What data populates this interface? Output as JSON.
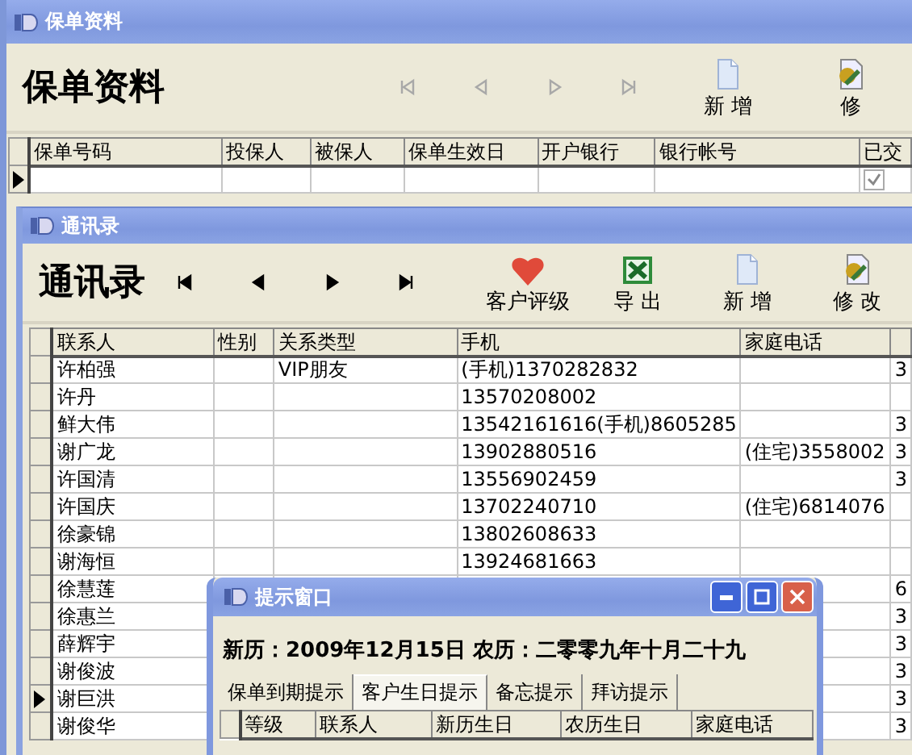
{
  "policy_window": {
    "title": "保单资料",
    "heading": "保单资料",
    "nav_buttons": [
      {
        "kind": "first",
        "disabled": true
      },
      {
        "kind": "prev",
        "disabled": true
      },
      {
        "kind": "next",
        "disabled": true
      },
      {
        "kind": "last",
        "disabled": true
      }
    ],
    "actions": [
      {
        "kind": "new",
        "label": "新 增"
      },
      {
        "kind": "edit",
        "label": "修"
      }
    ],
    "table": {
      "columns": [
        "保单号码",
        "投保人",
        "被保人",
        "保单生效日",
        "开户银行",
        "银行帐号",
        "已交"
      ],
      "rows": [
        {
          "current": true,
          "cells": [
            "",
            "",
            "",
            "",
            "",
            ""
          ],
          "paid_checked": true
        }
      ]
    }
  },
  "contacts_window": {
    "title": "通讯录",
    "heading": "通讯录",
    "nav_buttons": [
      {
        "kind": "first",
        "disabled": false
      },
      {
        "kind": "prev",
        "disabled": false
      },
      {
        "kind": "next",
        "disabled": false
      },
      {
        "kind": "last",
        "disabled": false
      }
    ],
    "actions": [
      {
        "kind": "rating",
        "label": "客户评级"
      },
      {
        "kind": "export",
        "label": "导 出"
      },
      {
        "kind": "new",
        "label": "新 增"
      },
      {
        "kind": "edit",
        "label": "修 改"
      }
    ],
    "table": {
      "columns": [
        "联系人",
        "性别",
        "关系类型",
        "手机",
        "家庭电话"
      ],
      "rows": [
        {
          "current": false,
          "cells": [
            "许柏强",
            "",
            "VIP朋友",
            "(手机)1370282832",
            "",
            "3"
          ]
        },
        {
          "current": false,
          "cells": [
            "许丹",
            "",
            "",
            "13570208002",
            "",
            ""
          ]
        },
        {
          "current": false,
          "cells": [
            "鲜大伟",
            "",
            "",
            "13542161616(手机)8605285",
            "",
            "3"
          ]
        },
        {
          "current": false,
          "cells": [
            "谢广龙",
            "",
            "",
            "13902880516",
            "(住宅)3558002",
            "3"
          ]
        },
        {
          "current": false,
          "cells": [
            "许国清",
            "",
            "",
            "13556902459",
            "",
            "3"
          ]
        },
        {
          "current": false,
          "cells": [
            "许国庆",
            "",
            "",
            "13702240710",
            "(住宅)6814076",
            ""
          ]
        },
        {
          "current": false,
          "cells": [
            "徐豪锦",
            "",
            "",
            "13802608633",
            "",
            ""
          ]
        },
        {
          "current": false,
          "cells": [
            "谢海恒",
            "",
            "",
            "13924681663",
            "",
            ""
          ]
        },
        {
          "current": false,
          "cells": [
            "徐慧莲",
            "",
            "",
            "",
            "",
            "6"
          ]
        },
        {
          "current": false,
          "cells": [
            "徐惠兰",
            "",
            "",
            "",
            "",
            "3"
          ]
        },
        {
          "current": false,
          "cells": [
            "薛辉宇",
            "",
            "",
            "",
            "",
            "3"
          ]
        },
        {
          "current": false,
          "cells": [
            "谢俊波",
            "",
            "",
            "",
            "",
            "3"
          ]
        },
        {
          "current": true,
          "cells": [
            "谢巨洪",
            "",
            "",
            "",
            "",
            "3"
          ]
        },
        {
          "current": false,
          "cells": [
            "谢俊华",
            "",
            "",
            "",
            "",
            "3"
          ]
        }
      ]
    }
  },
  "reminder_window": {
    "title": "提示窗口",
    "date_line": "新历：2009年12月15日 农历：二零零九年十月二十九",
    "tabs": [
      {
        "label": "保单到期提示",
        "selected": false
      },
      {
        "label": "客户生日提示",
        "selected": true
      },
      {
        "label": "备忘提示",
        "selected": false
      },
      {
        "label": "拜访提示",
        "selected": false
      }
    ],
    "table": {
      "columns": [
        "等级",
        "联系人",
        "新历生日",
        "农历生日",
        "家庭电话"
      ]
    }
  }
}
